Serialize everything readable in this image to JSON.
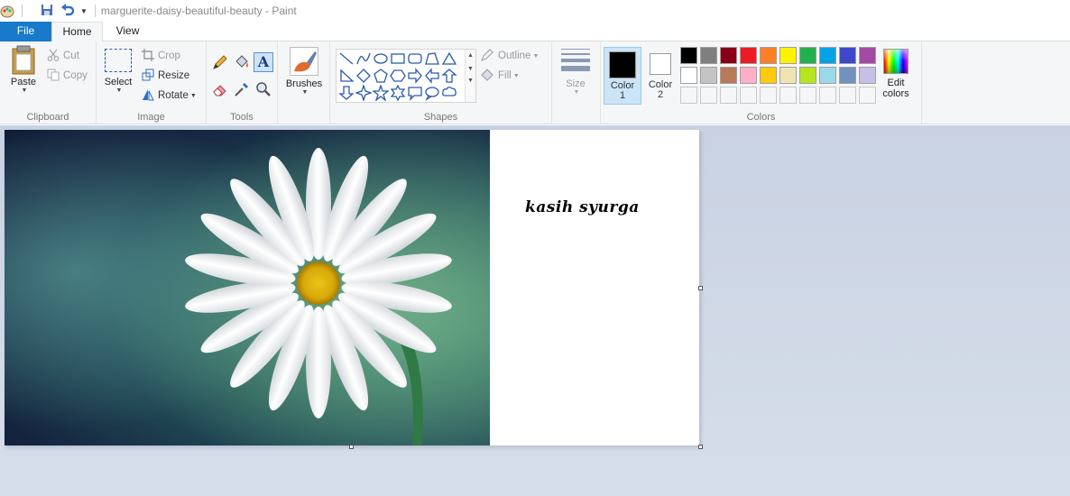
{
  "window": {
    "title": "marguerite-daisy-beautiful-beauty - Paint"
  },
  "tabs": [
    {
      "label": "File"
    },
    {
      "label": "Home"
    },
    {
      "label": "View"
    }
  ],
  "clipboard": {
    "paste_label": "Paste",
    "cut_label": "Cut",
    "copy_label": "Copy",
    "group_label": "Clipboard"
  },
  "image": {
    "select_label": "Select",
    "crop_label": "Crop",
    "resize_label": "Resize",
    "rotate_label": "Rotate",
    "group_label": "Image"
  },
  "tools": {
    "group_label": "Tools",
    "icons": [
      "pencil-icon",
      "fill-icon",
      "text-icon",
      "eraser-icon",
      "color-picker-icon",
      "magnifier-icon"
    ]
  },
  "brushes": {
    "label": "Brushes"
  },
  "shapes": {
    "outline_label": "Outline",
    "fill_label": "Fill",
    "group_label": "Shapes"
  },
  "size": {
    "label": "Size"
  },
  "colors": {
    "color1_label": "Color",
    "color1_num": "1",
    "color2_label": "Color",
    "color2_num": "2",
    "edit_label_1": "Edit",
    "edit_label_2": "colors",
    "group_label": "Colors",
    "color1": "#000000",
    "color2": "#ffffff",
    "palette_row1": [
      "#000000",
      "#7f7f7f",
      "#880015",
      "#ed1c24",
      "#ff7f27",
      "#fff200",
      "#22b14c",
      "#00a2e8",
      "#3f48cc",
      "#a349a4"
    ],
    "palette_row2": [
      "#ffffff",
      "#c3c3c3",
      "#b97a57",
      "#ffaec9",
      "#ffc90e",
      "#efe4b0",
      "#b5e61d",
      "#99d9ea",
      "#7092be",
      "#c8bfe7"
    ]
  },
  "canvas": {
    "text": "kasih syurga"
  }
}
